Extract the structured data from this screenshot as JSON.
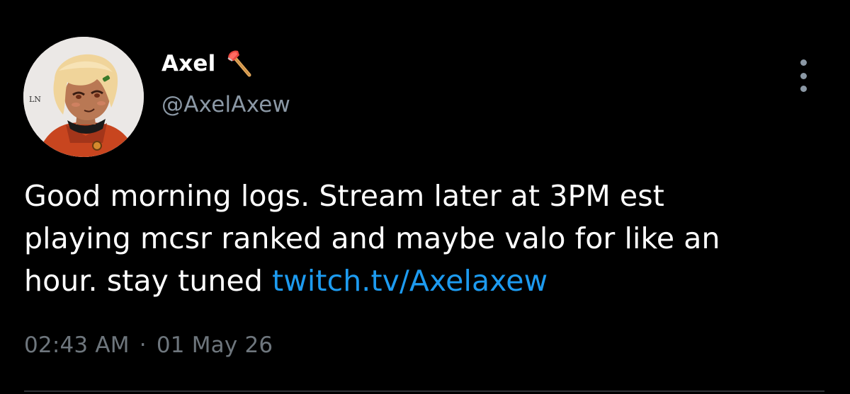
{
  "author": {
    "display_name": "Axel",
    "name_emoji": "axe-emoji",
    "handle": "@AxelAxew"
  },
  "tweet": {
    "text_lines": [
      "Good morning logs. Stream later at 3PM est",
      "playing mcsr ranked and maybe valo for like an",
      "hour. stay tuned "
    ],
    "link_text": "twitch.tv/Axelaxew"
  },
  "meta": {
    "time": "02:43 AM",
    "separator": "·",
    "date": "01 May 26"
  },
  "colors": {
    "background": "#000000",
    "text": "#ffffff",
    "secondary_text": "#8b98a5",
    "link": "#1d9bf0"
  },
  "icons": {
    "more": "vertical-ellipsis-icon"
  }
}
